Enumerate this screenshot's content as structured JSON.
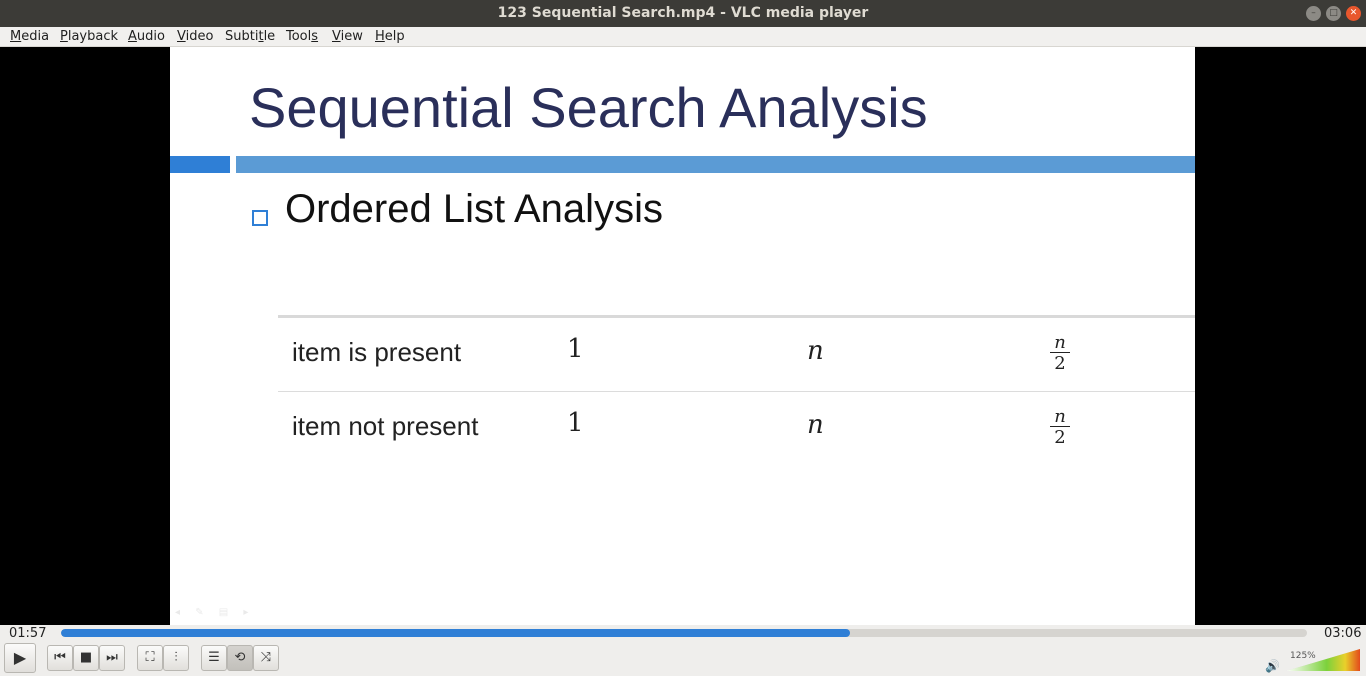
{
  "window": {
    "title": "123 Sequential Search.mp4 - VLC media player",
    "minimize_glyph": "–",
    "maximize_glyph": "□",
    "close_glyph": "✕"
  },
  "menu": [
    {
      "first": "M",
      "rest": "edia"
    },
    {
      "first": "P",
      "rest": "layback"
    },
    {
      "first": "A",
      "rest": "udio"
    },
    {
      "first": "V",
      "rest": "ideo"
    },
    {
      "first": "Subti",
      "mid": "t",
      "rest": "le"
    },
    {
      "first": "Tool",
      "mid": "s",
      "rest": ""
    },
    {
      "first": "V",
      "rest": "iew"
    },
    {
      "first": "H",
      "rest": "elp"
    }
  ],
  "slide": {
    "title": "Sequential Search Analysis",
    "bullet": "Ordered List Analysis",
    "rows": [
      {
        "label": "item is present",
        "best": "1",
        "worst": "n",
        "avg_num": "n",
        "avg_den": "2"
      },
      {
        "label": "item not present",
        "best": "1",
        "worst": "n",
        "avg_num": "n",
        "avg_den": "2"
      }
    ]
  },
  "playback": {
    "current_time": "01:57",
    "total_time": "03:06",
    "progress_percent": 63.3
  },
  "controls": {
    "play": "▶",
    "prev": "⏮",
    "stop": "■",
    "next": "⏭",
    "fullscreen": "⛶",
    "extended": "⫶",
    "playlist": "☰",
    "loop": "⟲",
    "shuffle": "⤨"
  },
  "volume": {
    "percent_label": "125%",
    "level_fraction": 1.0,
    "icon": "🔊"
  },
  "colors": {
    "accent": "#2f7fd6",
    "slide_title": "#2a2f5a",
    "close_button": "#e9572d"
  }
}
